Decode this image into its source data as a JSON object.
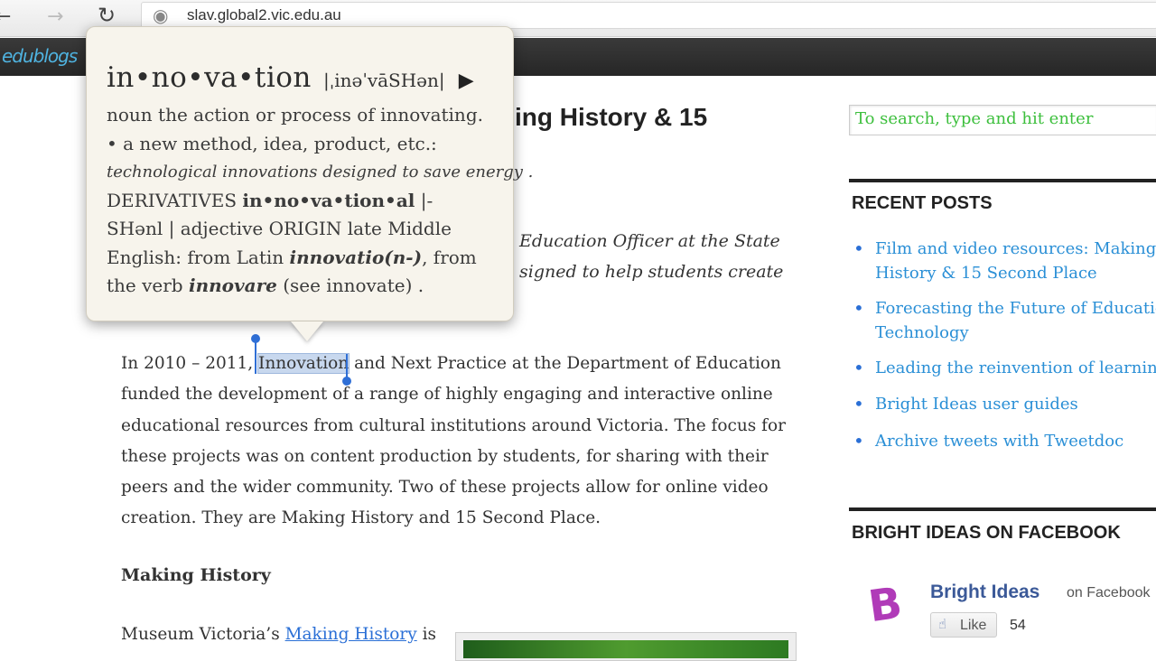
{
  "browser": {
    "back_icon": "back-arrow-icon",
    "forward_icon": "forward-arrow-icon",
    "reload_icon": "reload-icon",
    "site_icon": "globe-icon",
    "url": "slav.global2.vic.edu.au"
  },
  "site": {
    "logo_text": "edublogs"
  },
  "post": {
    "title_visible": "ing History & 15",
    "intro_line_1": "Education Officer at the State",
    "intro_line_2": "signed to help students create",
    "paragraph": {
      "line_1_before": "In 2010 – 2011, ",
      "line_1_selected": "Innovation",
      "line_1_after": " and Next Practice at the Department of Education",
      "line_2": "funded the development of a range of highly engaging and interactive online",
      "line_3": "educational resources from cultural institutions around Victoria. The focus for",
      "line_4": "these projects was on content production by students, for sharing with their",
      "line_5": "peers and the wider community. Two of these projects allow for online video",
      "line_6": "creation. They are Making History and 15 Second Place."
    },
    "section_heading": "Making History",
    "museum_before": "Museum Victoria’s ",
    "museum_link": "Making History",
    "museum_after": " is"
  },
  "dictionary": {
    "headword": "in•no•va•tion",
    "pronunciation": "|ˌinəˈvāSHən|",
    "play_icon": "play-icon",
    "line_1": "noun the action or process of innovating.",
    "line_2": "• a new method, idea, product, etc.:",
    "example": "technological innovations designed to save energy .",
    "line_4_prefix": "DERIVATIVES ",
    "line_4_bold": "in•no•va•tion•al",
    "line_4_suffix": " |-",
    "line_5": "SHənl | adjective ORIGIN late Middle",
    "line_6_prefix": "English: from Latin ",
    "line_6_term": "innovatio(n-)",
    "line_6_suffix": ", from",
    "line_7_prefix": "the verb ",
    "line_7_term": "innovare",
    "line_7_suffix": " (see innovate) ."
  },
  "sidebar": {
    "search_placeholder": "To search, type and hit enter",
    "recent_title": "RECENT POSTS",
    "recent_posts": [
      "Film and video resources: Making History & 15 Second Place",
      "Forecasting the Future of Education Technology",
      "Leading the reinvention of learning",
      "Bright Ideas user guides",
      "Archive tweets with Tweetdoc"
    ],
    "recent_lines": {
      "p0_l1": "Film and video resources: Making",
      "p0_l2": "History & 15 Second Place",
      "p1_l1": "Forecasting the Future of Education",
      "p1_l2": "Technology",
      "p2": "Leading the reinvention of learning",
      "p3": "Bright Ideas user guides",
      "p4": "Archive tweets with Tweetdoc"
    },
    "facebook_title": "BRIGHT IDEAS ON FACEBOOK",
    "facebook": {
      "avatar_letter": "B",
      "page_name": "Bright Ideas",
      "on_text": "on Facebook",
      "like_icon": "thumbs-up-icon",
      "like_label": "Like",
      "like_count": "54"
    }
  },
  "colors": {
    "link": "#2a8fd6",
    "search_text": "#3cbf3c",
    "facebook_blue": "#3b5998",
    "selection": "#c8d8ee",
    "popover_bg": "#f7f4ec"
  }
}
